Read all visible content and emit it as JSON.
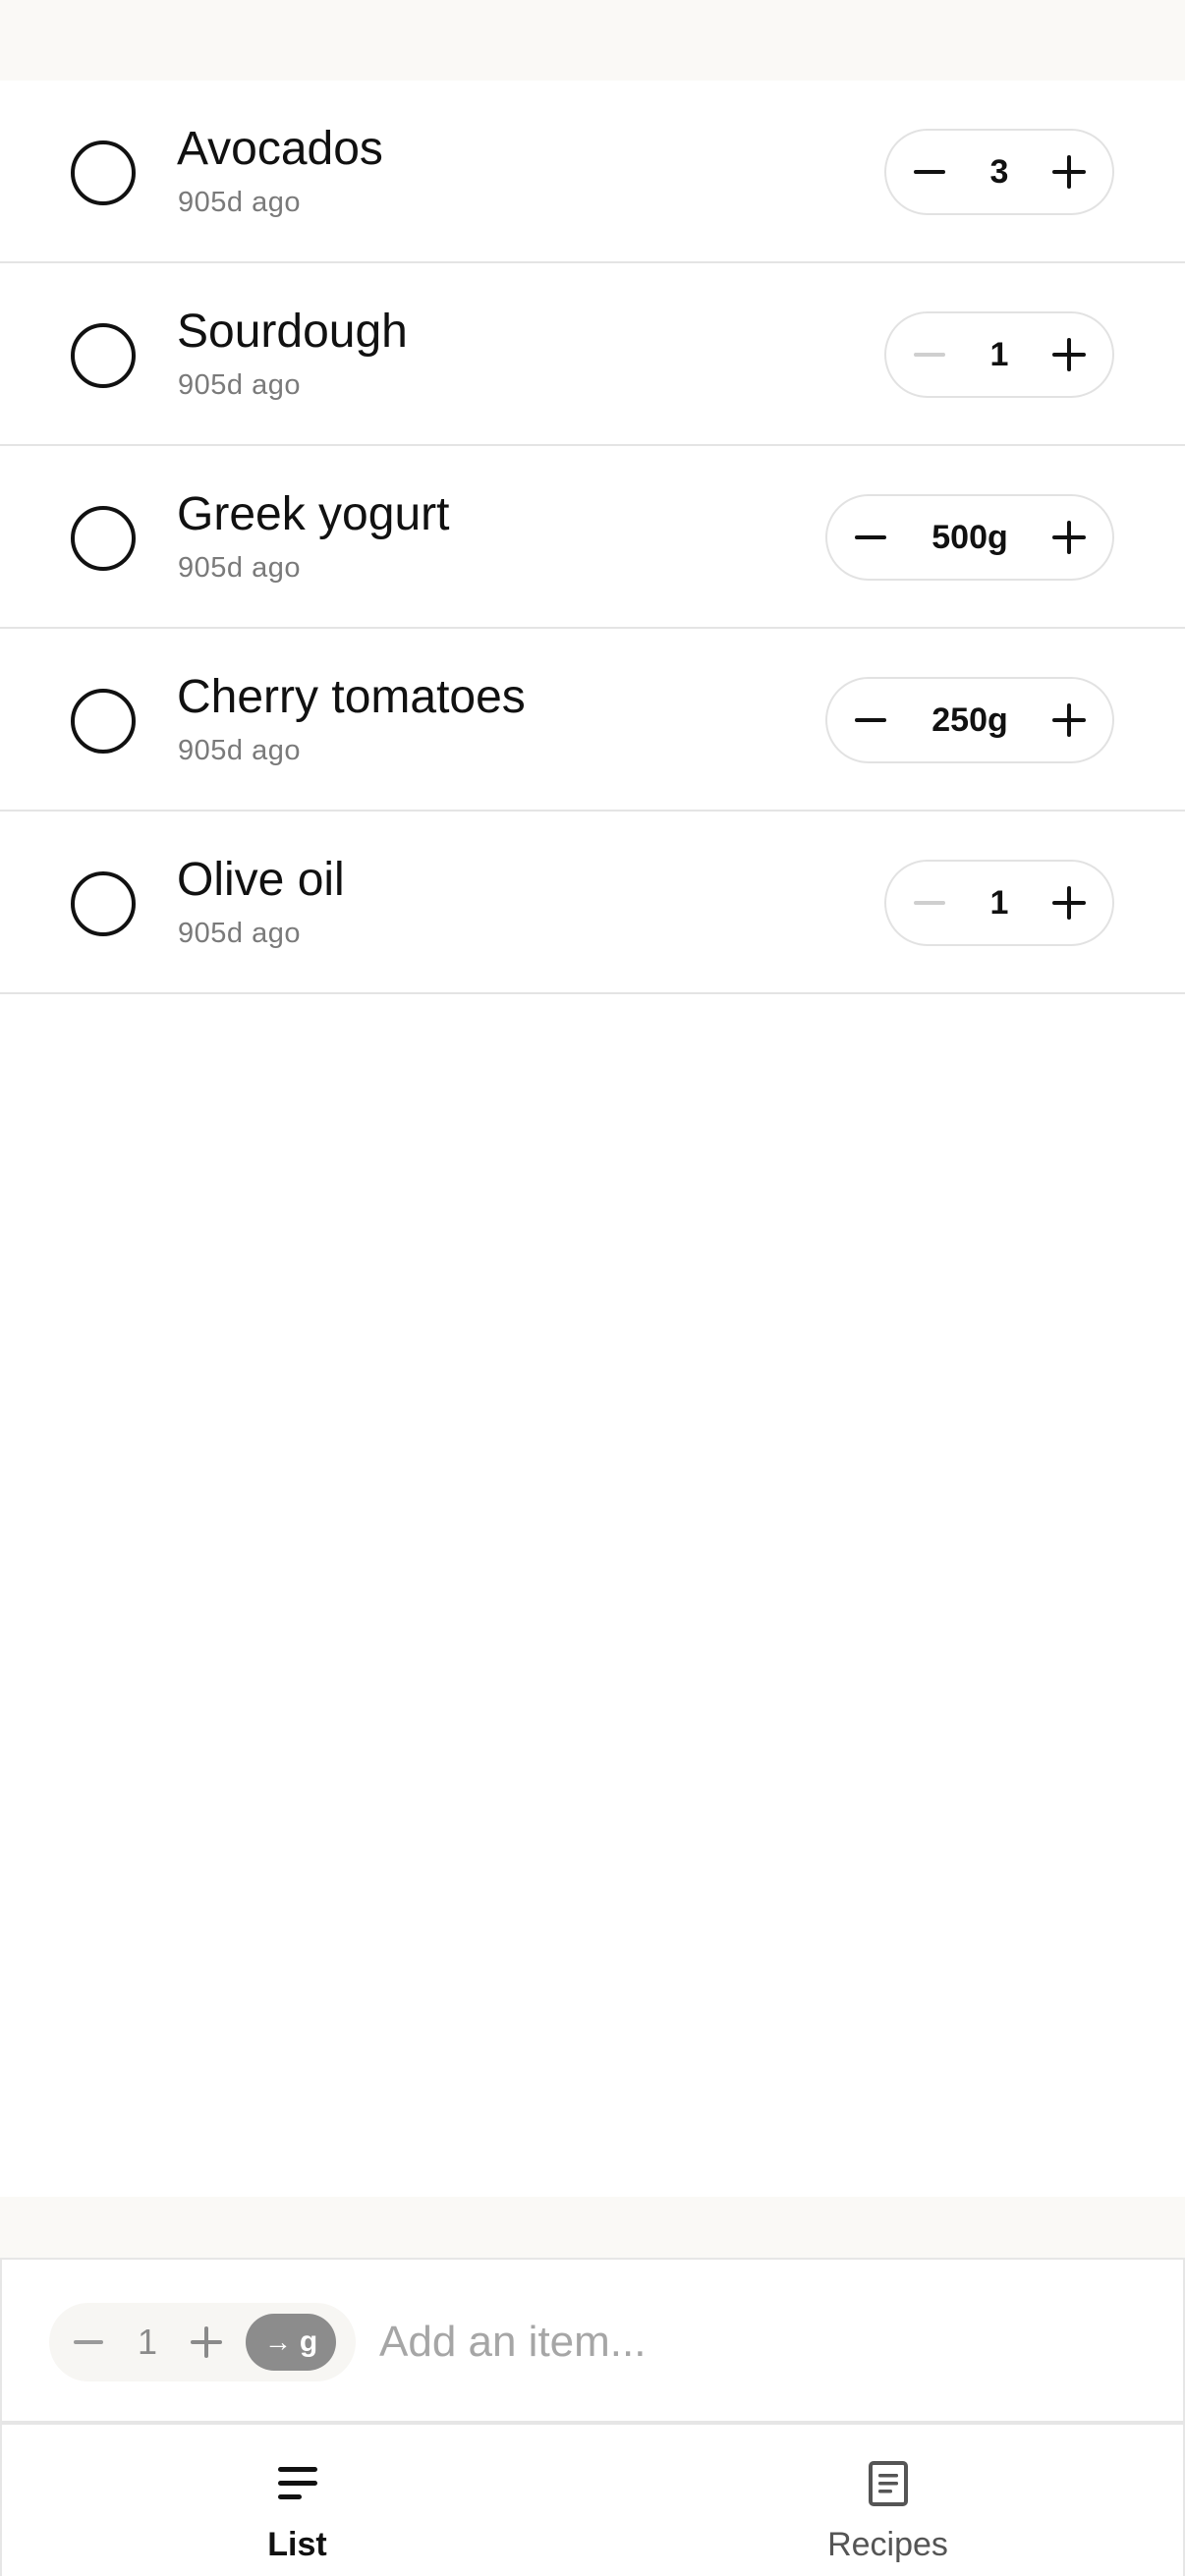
{
  "items": [
    {
      "name": "Avocados",
      "time": "905d ago",
      "quantity": "3",
      "minus_enabled": true
    },
    {
      "name": "Sourdough",
      "time": "905d ago",
      "quantity": "1",
      "minus_enabled": false
    },
    {
      "name": "Greek yogurt",
      "time": "905d ago",
      "quantity": "500g",
      "minus_enabled": true
    },
    {
      "name": "Cherry tomatoes",
      "time": "905d ago",
      "quantity": "250g",
      "minus_enabled": true
    },
    {
      "name": "Olive oil",
      "time": "905d ago",
      "quantity": "1",
      "minus_enabled": false
    }
  ],
  "composer": {
    "quantity": "1",
    "unit_label": "g",
    "unit_arrow": "→",
    "placeholder": "Add an item...",
    "value": ""
  },
  "tabs": [
    {
      "label": "List",
      "icon": "list-icon",
      "active": true
    },
    {
      "label": "Recipes",
      "icon": "recipes-icon",
      "active": false
    }
  ],
  "colors": {
    "background": "#ffffff",
    "header_background": "#faf9f6",
    "text": "#111111",
    "muted_text": "#7a7a7a",
    "divider": "#e4e4e4",
    "unit_chip": "#8c8c8c"
  }
}
